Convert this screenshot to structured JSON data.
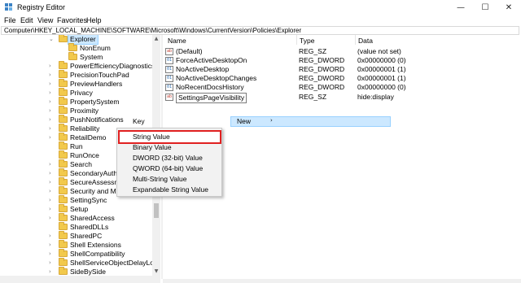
{
  "window": {
    "title": "Registry Editor",
    "minimize_glyph": "—",
    "maximize_glyph": "☐",
    "close_glyph": "✕"
  },
  "menu": [
    "File",
    "Edit",
    "View",
    "Favorites",
    "Help"
  ],
  "address": "Computer\\HKEY_LOCAL_MACHINE\\SOFTWARE\\Microsoft\\Windows\\CurrentVersion\\Policies\\Explorer",
  "tree": {
    "items": [
      {
        "label": "Explorer",
        "selected": true
      },
      {
        "label": "NonEnum"
      },
      {
        "label": "System"
      },
      {
        "label": "PowerEfficiencyDiagnostics"
      },
      {
        "label": "PrecisionTouchPad"
      },
      {
        "label": "PreviewHandlers"
      },
      {
        "label": "Privacy"
      },
      {
        "label": "PropertySystem"
      },
      {
        "label": "Proximity"
      },
      {
        "label": "PushNotifications"
      },
      {
        "label": "Reliability"
      },
      {
        "label": "RetailDemo"
      },
      {
        "label": "Run"
      },
      {
        "label": "RunOnce"
      },
      {
        "label": "Search"
      },
      {
        "label": "SecondaryAuthFac"
      },
      {
        "label": "SecureAssessment"
      },
      {
        "label": "Security and Main"
      },
      {
        "label": "SettingSync"
      },
      {
        "label": "Setup"
      },
      {
        "label": "SharedAccess"
      },
      {
        "label": "SharedDLLs"
      },
      {
        "label": "SharedPC"
      },
      {
        "label": "Shell Extensions"
      },
      {
        "label": "ShellCompatibility"
      },
      {
        "label": "ShellServiceObjectDelayLoad"
      },
      {
        "label": "SideBySide"
      }
    ]
  },
  "list": {
    "columns": [
      "Name",
      "Type",
      "Data"
    ],
    "rows": [
      {
        "name": "(Default)",
        "type": "REG_SZ",
        "data": "(value not set)",
        "icon": "string-value-icon"
      },
      {
        "name": "ForceActiveDesktopOn",
        "type": "REG_DWORD",
        "data": "0x00000000 (0)",
        "icon": "dword-value-icon"
      },
      {
        "name": "NoActiveDesktop",
        "type": "REG_DWORD",
        "data": "0x00000001 (1)",
        "icon": "dword-value-icon"
      },
      {
        "name": "NoActiveDesktopChanges",
        "type": "REG_DWORD",
        "data": "0x00000001 (1)",
        "icon": "dword-value-icon"
      },
      {
        "name": "NoRecentDocsHistory",
        "type": "REG_DWORD",
        "data": "0x00000000 (0)",
        "icon": "dword-value-icon"
      },
      {
        "name": "SettingsPageVisibility",
        "type": "REG_SZ",
        "data": "hide:display",
        "icon": "string-value-icon"
      }
    ]
  },
  "context_menu": {
    "key_label": "Key",
    "new_label": "New",
    "submenu_arrow": "›",
    "items": [
      "String Value",
      "Binary Value",
      "DWORD (32-bit) Value",
      "QWORD (64-bit) Value",
      "Multi-String Value",
      "Expandable String Value"
    ],
    "highlighted": "String Value"
  },
  "colors": {
    "selection": "#cce8ff",
    "highlight_border": "#e02020",
    "folder": "#f2c94c"
  }
}
